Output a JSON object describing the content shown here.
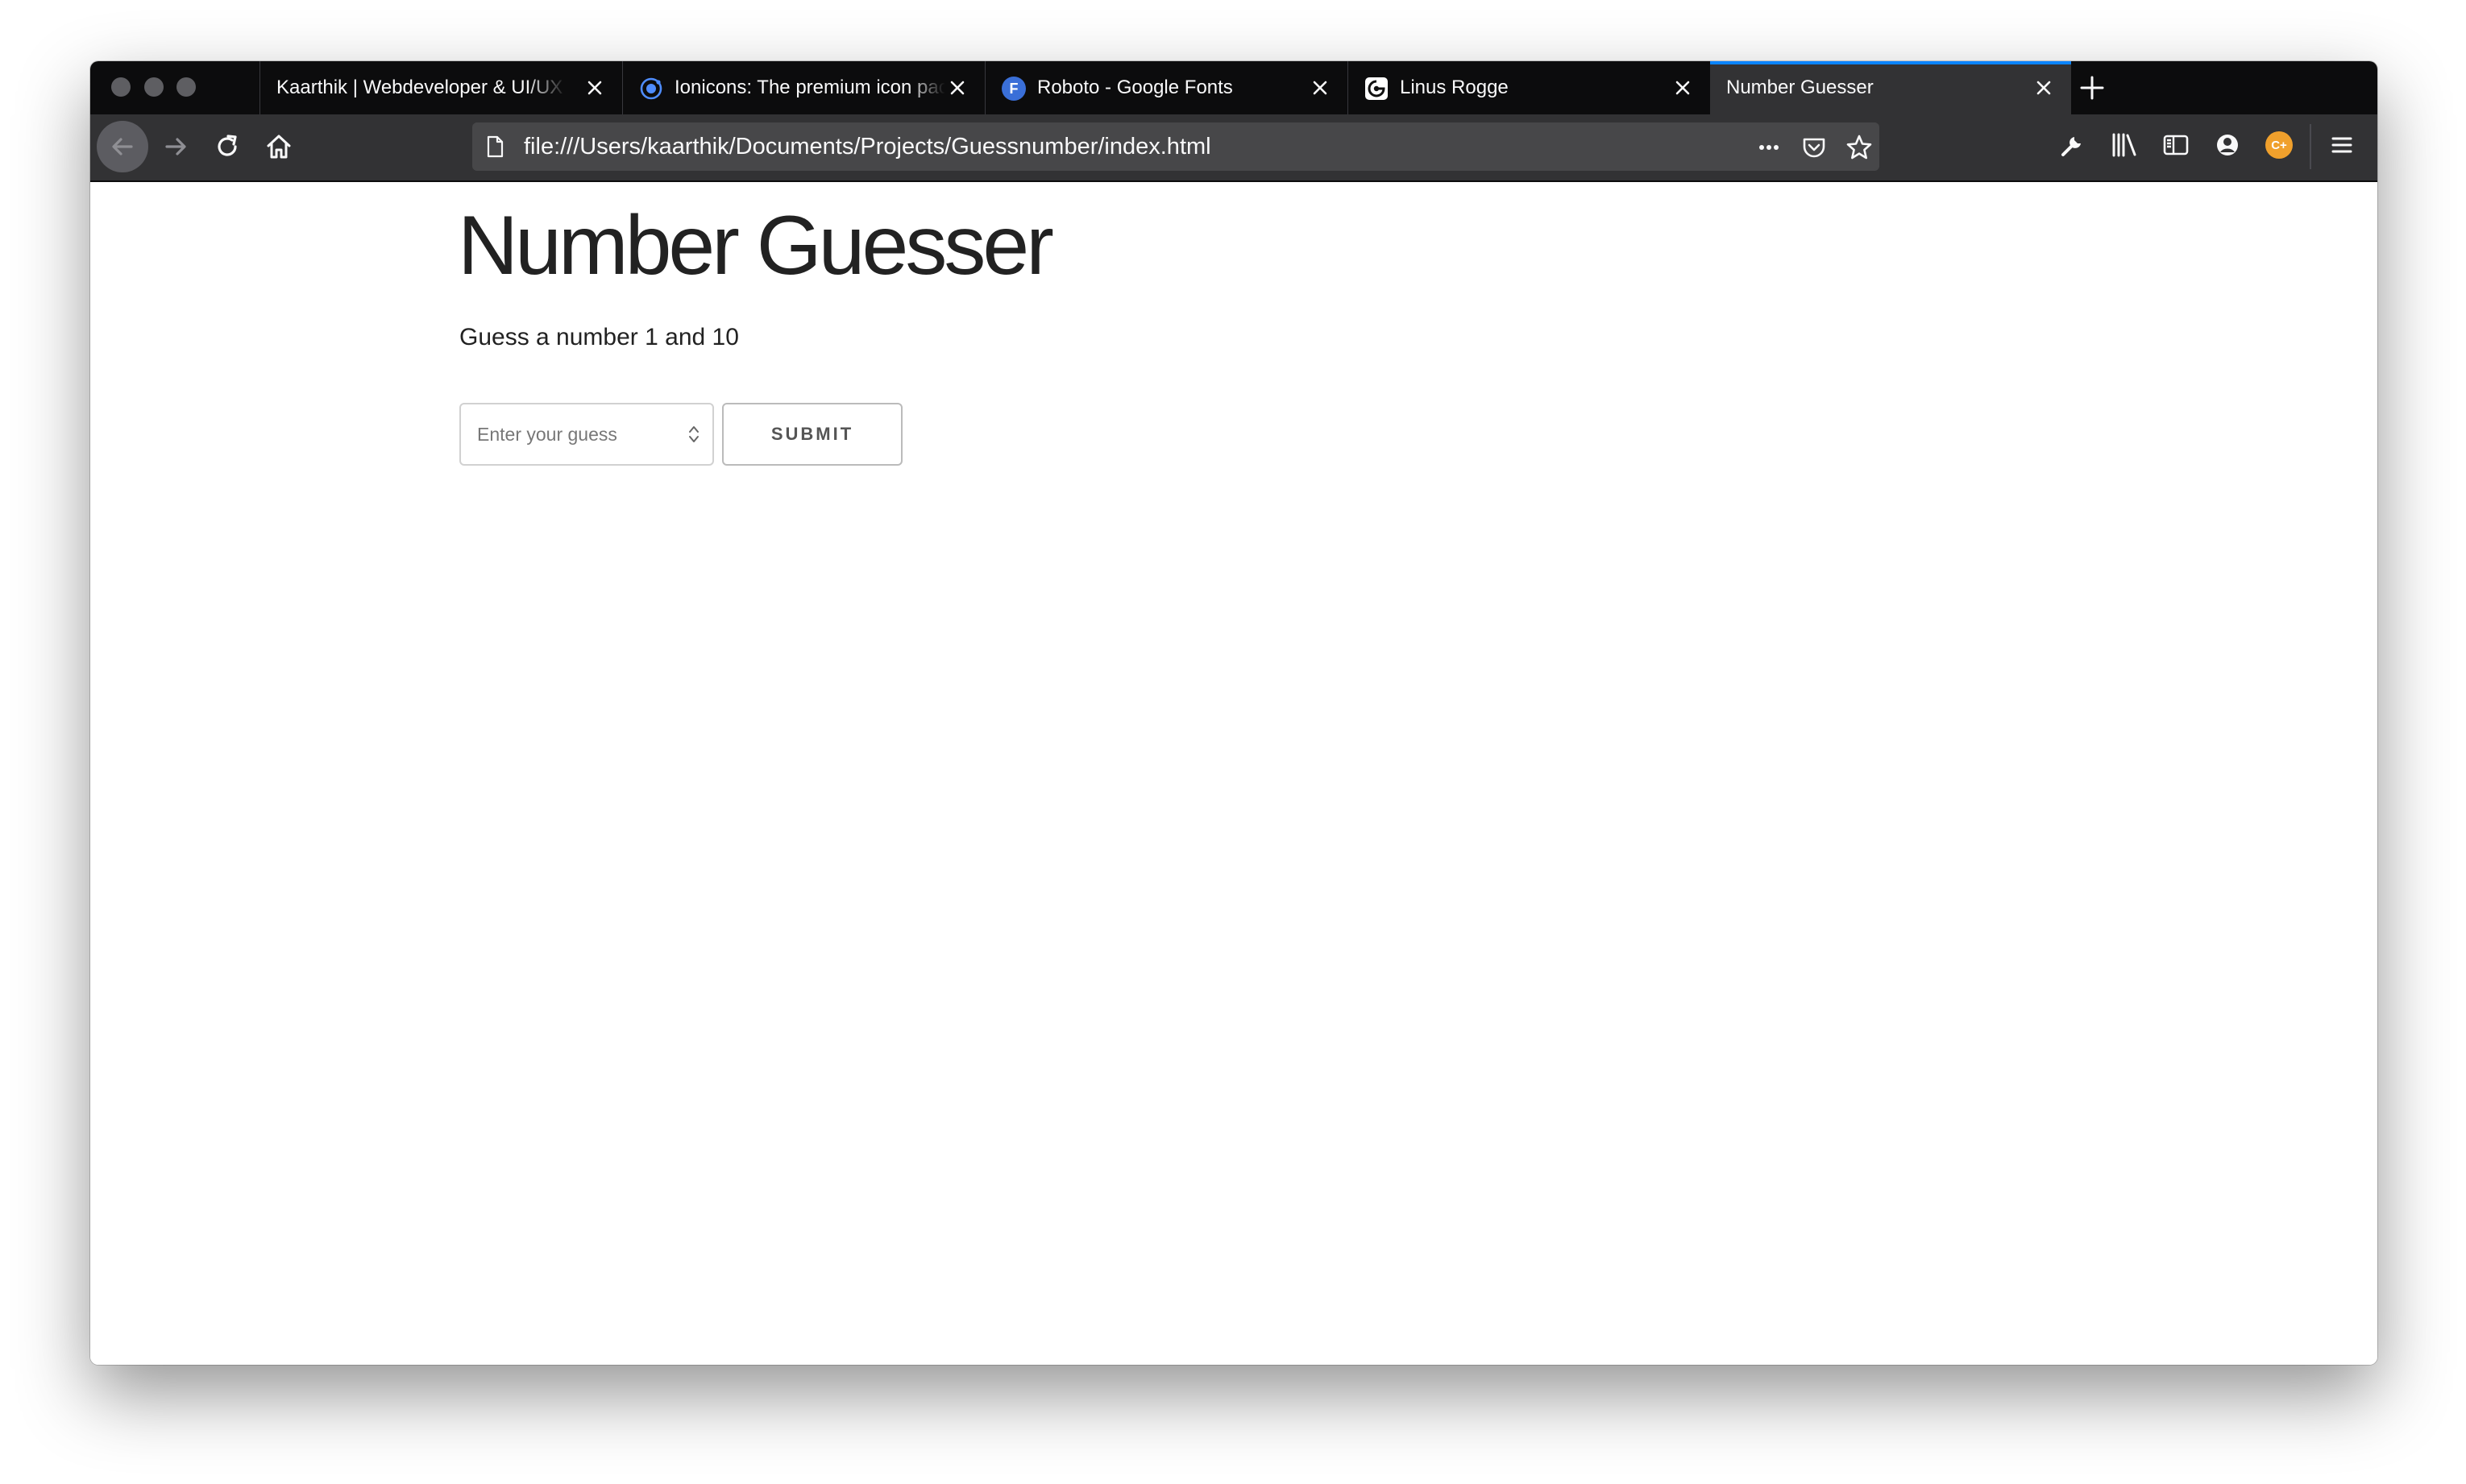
{
  "browser": {
    "tabs": [
      {
        "title": "Kaarthik | Webdeveloper & UI/UX Designer",
        "favicon": "none",
        "active": false
      },
      {
        "title": "Ionicons: The premium icon pack",
        "favicon": "ionicons-ring-icon",
        "active": false
      },
      {
        "title": "Roboto - Google Fonts",
        "favicon": "google-fonts-icon",
        "favicon_text": "F",
        "active": false
      },
      {
        "title": "Linus Rogge",
        "favicon": "linus-rogge-logo-icon",
        "active": false
      },
      {
        "title": "Number Guesser",
        "favicon": "none",
        "active": true
      }
    ],
    "address_bar": {
      "url": "file:///Users/kaarthik/Documents/Projects/Guessnumber/index.html"
    },
    "toolbar_icons": [
      "back-arrow-icon",
      "forward-arrow-icon",
      "reload-icon",
      "home-icon",
      "more-actions-icon",
      "pocket-icon",
      "bookmark-star-icon",
      "wrench-icon",
      "library-icon",
      "sidebar-icon",
      "account-icon",
      "extension-icon",
      "hamburger-menu-icon"
    ],
    "extension_badge": "C+",
    "colors": {
      "tabstrip": "#0c0c0d",
      "toolbar": "#323234",
      "active_tab_accent": "#0a84ff",
      "extension": "#f0a02c"
    }
  },
  "page": {
    "title": "Number Guesser",
    "description": "Guess a number 1 and 10",
    "guess_input": {
      "placeholder": "Enter your guess",
      "value": ""
    },
    "submit_label": "SUBMIT"
  }
}
